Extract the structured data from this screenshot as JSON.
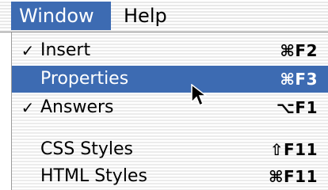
{
  "menubar": {
    "items": [
      {
        "label": "Window",
        "active": true
      },
      {
        "label": "Help",
        "active": false
      }
    ]
  },
  "menu": {
    "items": [
      {
        "label": "Insert",
        "checked": true,
        "check_glyph": "✓",
        "shortcut": "⌘F2",
        "selected": false
      },
      {
        "label": "Properties",
        "checked": false,
        "check_glyph": "",
        "shortcut": "⌘F3",
        "selected": true
      },
      {
        "label": "Answers",
        "checked": true,
        "check_glyph": "✓",
        "shortcut": "⌥F1",
        "selected": false
      },
      {
        "label": "CSS Styles",
        "checked": false,
        "check_glyph": "",
        "shortcut": "⇧F11",
        "selected": false
      },
      {
        "label": "HTML Styles",
        "checked": false,
        "check_glyph": "",
        "shortcut": "⌘F11",
        "selected": false
      }
    ]
  },
  "colors": {
    "highlight": "#3d6bb2",
    "highlight_text": "#ffffff",
    "text": "#000000"
  },
  "cursor": {
    "icon": "arrow-pointer-icon"
  }
}
